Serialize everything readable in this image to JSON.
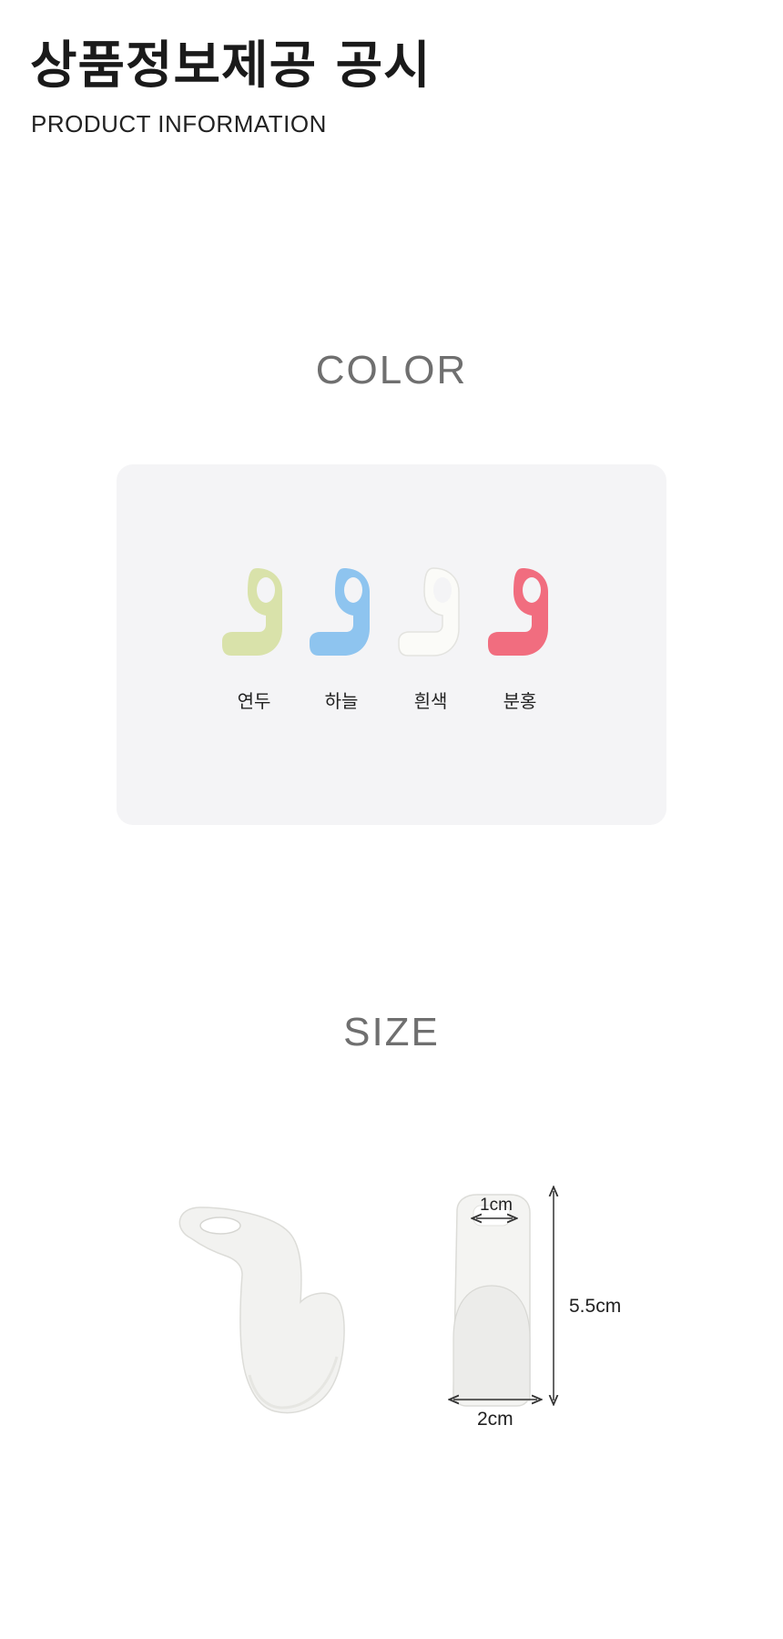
{
  "header": {
    "title": "상품정보제공 공시",
    "subtitle": "PRODUCT INFORMATION"
  },
  "color_section": {
    "heading": "COLOR",
    "swatches": [
      {
        "label": "연두",
        "color": "#d9e2aa"
      },
      {
        "label": "하늘",
        "color": "#8ec4ef"
      },
      {
        "label": "흰색",
        "color": "#f1f1ee"
      },
      {
        "label": "분홍",
        "color": "#f16d7f"
      }
    ]
  },
  "size_section": {
    "heading": "SIZE",
    "hole_width": "1cm",
    "height": "5.5cm",
    "width": "2cm"
  }
}
